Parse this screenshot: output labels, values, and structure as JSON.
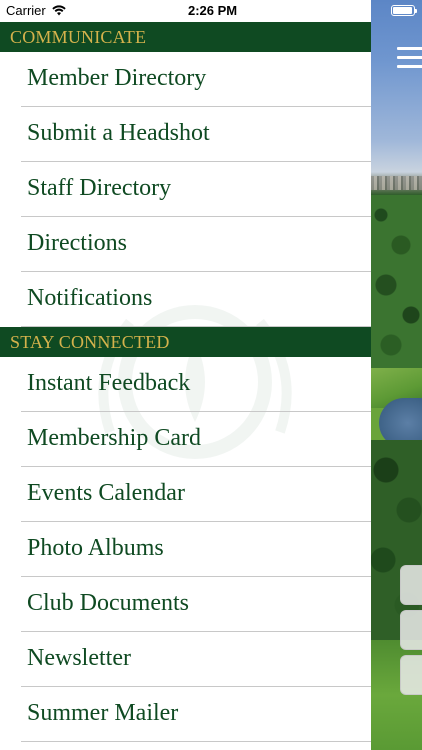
{
  "status_bar": {
    "carrier": "Carrier",
    "time": "2:26 PM"
  },
  "colors": {
    "header_bg": "#0f4a22",
    "header_text": "#d4b24c",
    "item_text": "#0f4a22",
    "divider": "#c8c8c8"
  },
  "icons": {
    "wifi": "wifi-icon",
    "battery": "battery-icon",
    "menu": "hamburger-menu-icon"
  },
  "menu": {
    "sections": [
      {
        "title": "COMMUNICATE",
        "items": [
          {
            "label": "Member Directory"
          },
          {
            "label": "Submit a Headshot"
          },
          {
            "label": "Staff Directory"
          },
          {
            "label": "Directions"
          },
          {
            "label": "Notifications"
          }
        ]
      },
      {
        "title": "STAY CONNECTED",
        "items": [
          {
            "label": "Instant Feedback"
          },
          {
            "label": "Membership Card"
          },
          {
            "label": "Events Calendar"
          },
          {
            "label": "Photo Albums"
          },
          {
            "label": "Club Documents"
          },
          {
            "label": "Newsletter"
          },
          {
            "label": "Summer Mailer"
          }
        ]
      }
    ]
  }
}
